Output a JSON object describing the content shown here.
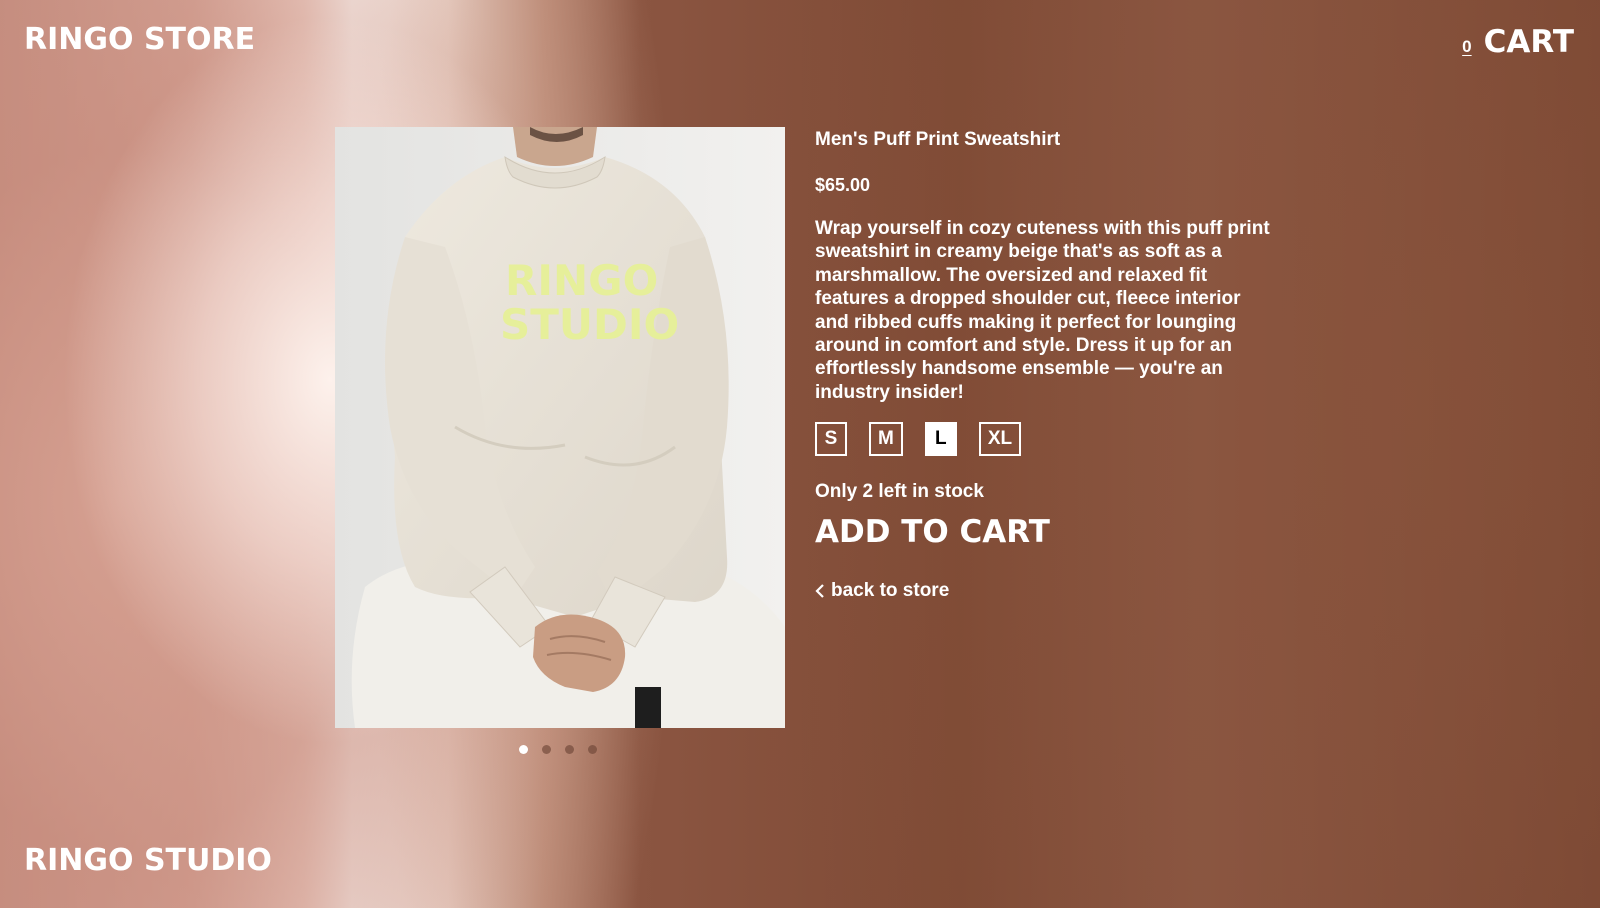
{
  "header": {
    "brand": "RINGO STORE",
    "cart_count": "0",
    "cart_label": "CART"
  },
  "product": {
    "title": "Men's Puff Print Sweatshirt",
    "price": "$65.00",
    "description": "Wrap yourself in cozy cuteness with this puff print sweatshirt in creamy beige that's as soft as a marshmallow. The oversized and relaxed fit features a dropped shoulder cut, fleece interior and ribbed cuffs making it perfect for lounging around in comfort and style. Dress it up for an effortlessly handsome ensemble — you're an industry insider!",
    "sizes": [
      "S",
      "M",
      "L",
      "XL"
    ],
    "selected_size": "L",
    "stock_text": "Only 2 left in stock",
    "add_to_cart_label": "ADD TO CART",
    "back_label": "back to store",
    "image_print_text": [
      "RINGO",
      "STUDIO"
    ],
    "carousel": {
      "count": 4,
      "active": 1
    }
  },
  "footer": {
    "brand": "RINGO STUDIO"
  },
  "colors": {
    "text": "#ffffff",
    "background_brown": "#7e4a35",
    "background_pink": "#d4a396",
    "sweatshirt": "#e9e4da",
    "print": "#e6ef9a"
  }
}
